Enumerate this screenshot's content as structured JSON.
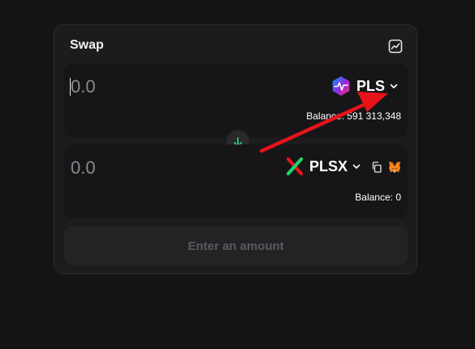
{
  "swap": {
    "title": "Swap",
    "chart_icon": "chart-line-icon",
    "from": {
      "amount_placeholder": "0.0",
      "token_symbol": "PLS",
      "token_icon": "pulsechain-logo-icon",
      "balance_text": "Balance: 591 313,348"
    },
    "switch_icon": "arrow-down-icon",
    "to": {
      "amount_placeholder": "0.0",
      "token_symbol": "PLSX",
      "token_icon": "pulsex-logo-icon",
      "copy_icon": "copy-icon",
      "wallet_icon": "metamask-icon",
      "balance_text": "Balance: 0"
    },
    "action_label": "Enter an amount"
  },
  "colors": {
    "background": "#141415",
    "card": "#1c1c1e",
    "panel": "#161618",
    "accent_green": "#2ecc71",
    "annotation_red": "#e8131b"
  }
}
